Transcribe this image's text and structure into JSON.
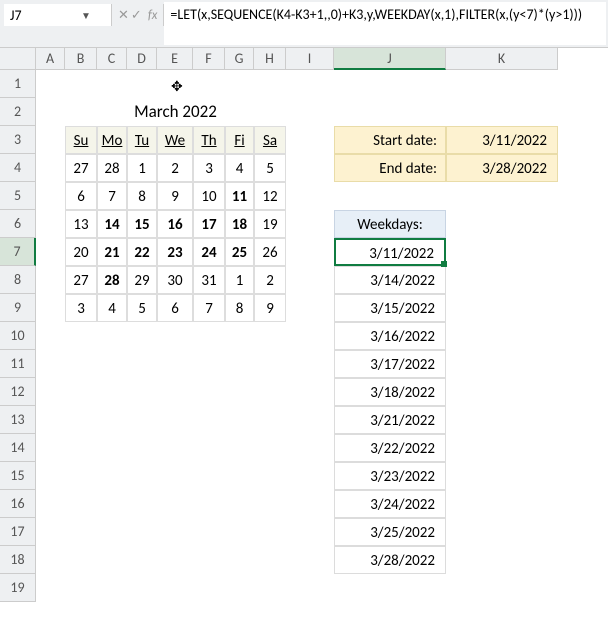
{
  "namebox": "J7",
  "formula": "=LET(x,SEQUENCE(K4-K3+1,,0)+K3,y,WEEKDAY(x,1),FILTER(x,(y<7)*(y>1)))",
  "cols": [
    "A",
    "B",
    "C",
    "D",
    "E",
    "F",
    "G",
    "H",
    "I",
    "J",
    "K"
  ],
  "row_count": 19,
  "cal_title": "March 2022",
  "cal_heads": [
    "Su",
    "Mo",
    "Tu",
    "We",
    "Th",
    "Fi",
    "Sa"
  ],
  "cal_rows": [
    [
      {
        "v": "27"
      },
      {
        "v": "28"
      },
      {
        "v": "1"
      },
      {
        "v": "2"
      },
      {
        "v": "3"
      },
      {
        "v": "4"
      },
      {
        "v": "5"
      }
    ],
    [
      {
        "v": "6"
      },
      {
        "v": "7"
      },
      {
        "v": "8"
      },
      {
        "v": "9"
      },
      {
        "v": "10"
      },
      {
        "v": "11",
        "b": true
      },
      {
        "v": "12"
      }
    ],
    [
      {
        "v": "13"
      },
      {
        "v": "14",
        "b": true
      },
      {
        "v": "15",
        "b": true
      },
      {
        "v": "16",
        "b": true
      },
      {
        "v": "17",
        "b": true
      },
      {
        "v": "18",
        "b": true
      },
      {
        "v": "19"
      }
    ],
    [
      {
        "v": "20"
      },
      {
        "v": "21",
        "b": true
      },
      {
        "v": "22",
        "b": true
      },
      {
        "v": "23",
        "b": true
      },
      {
        "v": "24",
        "b": true
      },
      {
        "v": "25",
        "b": true
      },
      {
        "v": "26"
      }
    ],
    [
      {
        "v": "27"
      },
      {
        "v": "28",
        "b": true
      },
      {
        "v": "29"
      },
      {
        "v": "30"
      },
      {
        "v": "31"
      },
      {
        "v": "1"
      },
      {
        "v": "2"
      }
    ],
    [
      {
        "v": "3"
      },
      {
        "v": "4"
      },
      {
        "v": "5"
      },
      {
        "v": "6"
      },
      {
        "v": "7"
      },
      {
        "v": "8"
      },
      {
        "v": "9"
      }
    ]
  ],
  "labels": {
    "start": "Start date:",
    "end": "End date:",
    "weekdays": "Weekdays:"
  },
  "start_date": "3/11/2022",
  "end_date": "3/28/2022",
  "weekdays": [
    "3/11/2022",
    "3/14/2022",
    "3/15/2022",
    "3/16/2022",
    "3/17/2022",
    "3/18/2022",
    "3/21/2022",
    "3/22/2022",
    "3/23/2022",
    "3/24/2022",
    "3/25/2022",
    "3/28/2022"
  ]
}
